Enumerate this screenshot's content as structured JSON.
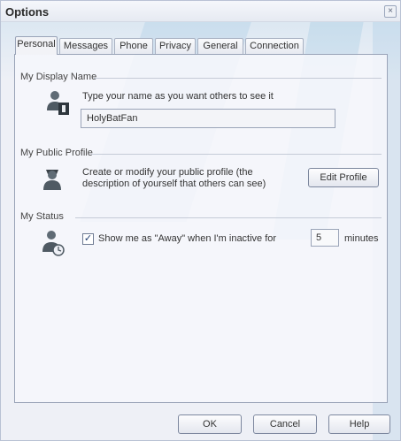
{
  "window": {
    "title": "Options",
    "close_glyph": "×"
  },
  "tabs": [
    {
      "label": "Personal",
      "active": true
    },
    {
      "label": "Messages",
      "active": false
    },
    {
      "label": "Phone",
      "active": false
    },
    {
      "label": "Privacy",
      "active": false
    },
    {
      "label": "General",
      "active": false
    },
    {
      "label": "Connection",
      "active": false
    }
  ],
  "display_name": {
    "group_label": "My Display Name",
    "instruction": "Type your name as you want others to see it",
    "value": "HolyBatFan"
  },
  "public_profile": {
    "group_label": "My Public Profile",
    "description_line1": "Create or modify your public profile (the",
    "description_line2": "description of yourself that others can see)",
    "edit_button": "Edit Profile"
  },
  "status": {
    "group_label": "My Status",
    "checkbox_label": "Show me as \"Away\" when I'm inactive for",
    "checked": true,
    "minutes_value": "5",
    "minutes_unit": "minutes"
  },
  "footer": {
    "ok": "OK",
    "cancel": "Cancel",
    "help": "Help"
  },
  "colors": {
    "accent": "#7bb8d8",
    "panel_border": "#9aa4b8",
    "window_bg": "#eef0f6"
  },
  "icons": [
    "close-icon",
    "user-name-icon",
    "user-profile-icon",
    "user-status-icon",
    "checkmark-icon"
  ]
}
